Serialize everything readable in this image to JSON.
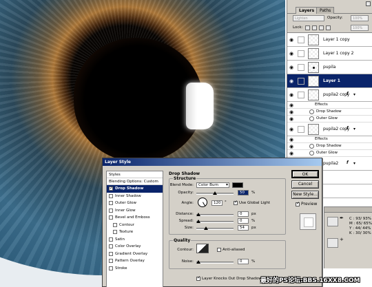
{
  "layers_panel": {
    "tabs": [
      "Layers",
      "Paths"
    ],
    "blend_mode": "Lighten",
    "opacity_label": "Opacity:",
    "opacity_value": "100%",
    "lock_label": "Lock:",
    "fill_value": "100%",
    "rows": [
      {
        "type": "layer",
        "name": "Layer 1 copy",
        "selected": false,
        "fx": false
      },
      {
        "type": "layer",
        "name": "Layer 1 copy 2",
        "selected": false,
        "fx": false
      },
      {
        "type": "layer",
        "name": "pupila",
        "selected": false,
        "fx": false
      },
      {
        "type": "layer",
        "name": "Layer 1",
        "selected": true,
        "fx": false
      },
      {
        "type": "layer",
        "name": "pupila2 copy",
        "selected": false,
        "fx": true
      },
      {
        "type": "effect-head",
        "name": "Effects"
      },
      {
        "type": "effect",
        "name": "Drop Shadow"
      },
      {
        "type": "effect",
        "name": "Outer Glow"
      },
      {
        "type": "layer",
        "name": "pupila2 copy",
        "selected": false,
        "fx": true
      },
      {
        "type": "effect-head",
        "name": "Effects"
      },
      {
        "type": "effect",
        "name": "Drop Shadow"
      },
      {
        "type": "effect",
        "name": "Outer Glow"
      },
      {
        "type": "layer",
        "name": "pupila2",
        "selected": false,
        "fx": true
      },
      {
        "type": "layer",
        "name": "",
        "selected": false,
        "fx": false
      },
      {
        "type": "layer",
        "name": "",
        "selected": false,
        "fx": false
      }
    ]
  },
  "info_panel": {
    "lines": [
      "C : 93/ 93%",
      "M : 65/ 65%",
      "Y : 44/ 44%",
      "K : 30/ 30%"
    ],
    "picker_a": "✒",
    "picker_b": "+"
  },
  "dialog": {
    "title": "Layer Style",
    "styles_header": "Styles",
    "blending_options": "Blending Options: Custom",
    "style_items": [
      {
        "label": "Drop Shadow",
        "checked": true,
        "selected": true,
        "sub": false
      },
      {
        "label": "Inner Shadow",
        "checked": false,
        "selected": false,
        "sub": false
      },
      {
        "label": "Outer Glow",
        "checked": false,
        "selected": false,
        "sub": false
      },
      {
        "label": "Inner Glow",
        "checked": false,
        "selected": false,
        "sub": false
      },
      {
        "label": "Bevel and Emboss",
        "checked": false,
        "selected": false,
        "sub": false
      },
      {
        "label": "Contour",
        "checked": false,
        "selected": false,
        "sub": true
      },
      {
        "label": "Texture",
        "checked": false,
        "selected": false,
        "sub": true
      },
      {
        "label": "Satin",
        "checked": false,
        "selected": false,
        "sub": false
      },
      {
        "label": "Color Overlay",
        "checked": false,
        "selected": false,
        "sub": false
      },
      {
        "label": "Gradient Overlay",
        "checked": false,
        "selected": false,
        "sub": false
      },
      {
        "label": "Pattern Overlay",
        "checked": false,
        "selected": false,
        "sub": false
      },
      {
        "label": "Stroke",
        "checked": false,
        "selected": false,
        "sub": false
      }
    ],
    "section_title": "Drop Shadow",
    "structure_title": "Structure",
    "blend_mode_label": "Blend Mode:",
    "blend_mode_value": "Color Burn",
    "shadow_color": "#000000",
    "opacity_label": "Opacity:",
    "opacity_value": "50",
    "opacity_fraction": 0.5,
    "percent": "%",
    "angle_label": "Angle:",
    "angle_value": "120",
    "angle_degrees": 120,
    "global_light_label": "Use Global Light",
    "global_light_checked": true,
    "distance_label": "Distance:",
    "distance_value": "0",
    "distance_fraction": 0.0,
    "px": "px",
    "spread_label": "Spread:",
    "spread_value": "0",
    "spread_fraction": 0.0,
    "size_label": "Size:",
    "size_value": "54",
    "size_fraction": 0.22,
    "quality_title": "Quality",
    "contour_label": "Contour:",
    "anti_alias_label": "Anti-aliased",
    "noise_label": "Noise:",
    "noise_value": "0",
    "noise_fraction": 0.0,
    "knockout_label": "Layer Knocks Out Drop Shadow",
    "knockout_checked": true,
    "buttons": {
      "ok": "OK",
      "cancel": "Cancel",
      "new_style": "New Style..."
    },
    "preview_label": "Preview",
    "preview_checked": true
  },
  "watermark": "最好的PS论坛:BBS.16XX8.COM"
}
